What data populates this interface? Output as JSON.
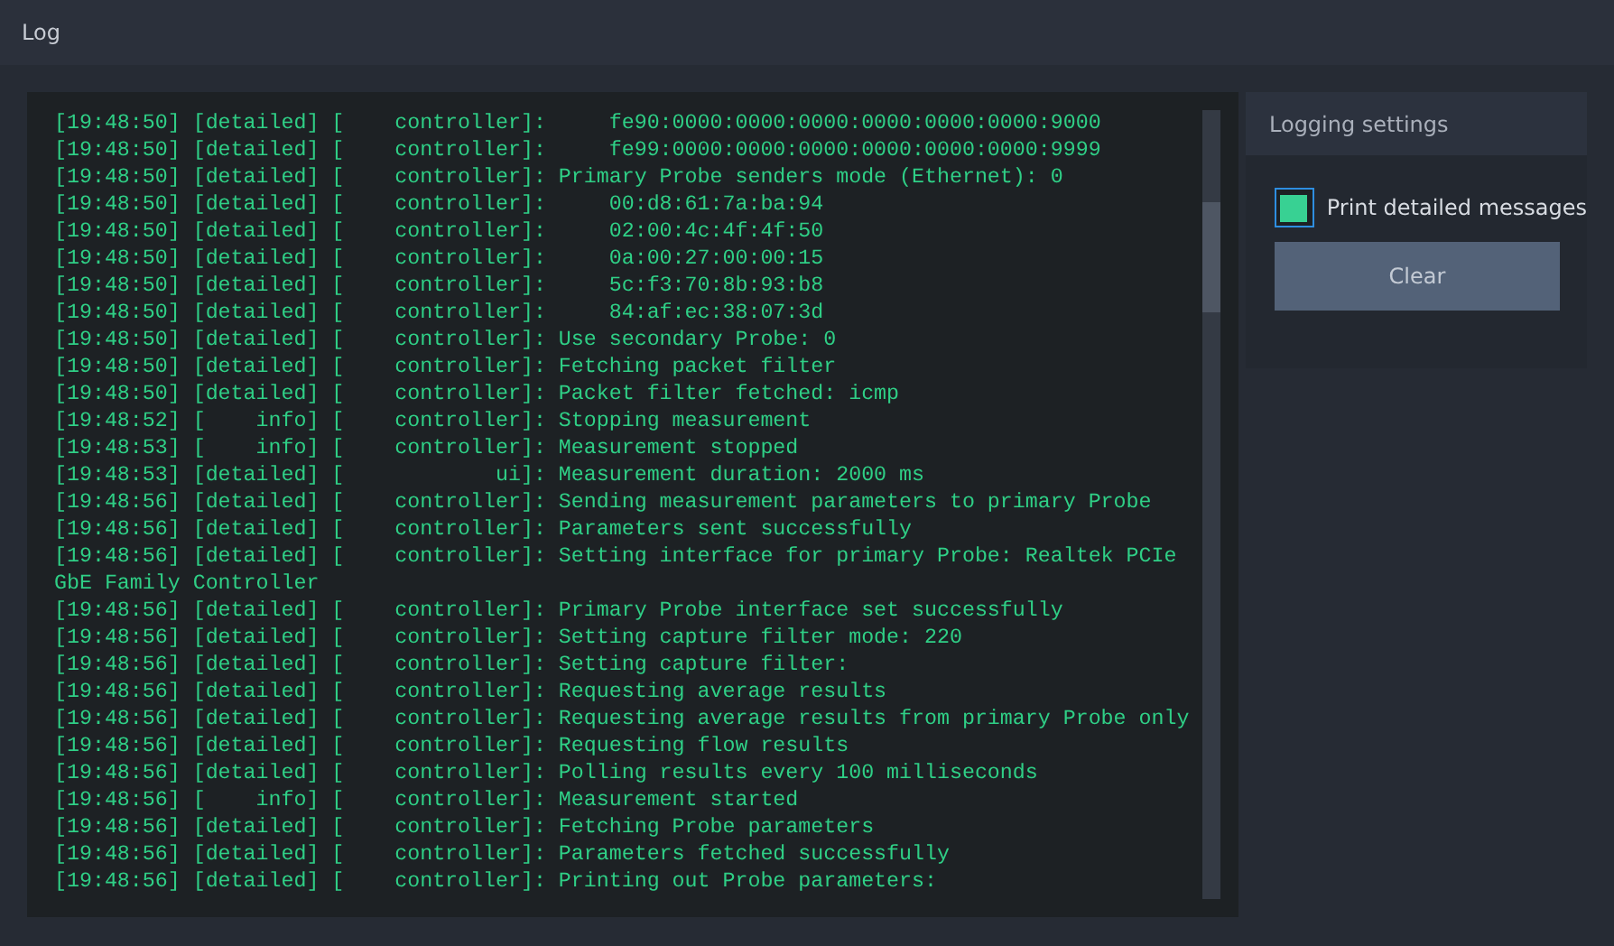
{
  "window": {
    "title": "Log"
  },
  "log": {
    "lines": [
      "[19:48:50] [detailed] [    controller]:     fe90:0000:0000:0000:0000:0000:0000:9000",
      "[19:48:50] [detailed] [    controller]:     fe99:0000:0000:0000:0000:0000:0000:9999",
      "[19:48:50] [detailed] [    controller]: Primary Probe senders mode (Ethernet): 0",
      "[19:48:50] [detailed] [    controller]:     00:d8:61:7a:ba:94",
      "[19:48:50] [detailed] [    controller]:     02:00:4c:4f:4f:50",
      "[19:48:50] [detailed] [    controller]:     0a:00:27:00:00:15",
      "[19:48:50] [detailed] [    controller]:     5c:f3:70:8b:93:b8",
      "[19:48:50] [detailed] [    controller]:     84:af:ec:38:07:3d",
      "[19:48:50] [detailed] [    controller]: Use secondary Probe: 0",
      "[19:48:50] [detailed] [    controller]: Fetching packet filter",
      "[19:48:50] [detailed] [    controller]: Packet filter fetched: icmp",
      "[19:48:52] [    info] [    controller]: Stopping measurement",
      "[19:48:53] [    info] [    controller]: Measurement stopped",
      "[19:48:53] [detailed] [            ui]: Measurement duration: 2000 ms",
      "[19:48:56] [detailed] [    controller]: Sending measurement parameters to primary Probe",
      "[19:48:56] [detailed] [    controller]: Parameters sent successfully",
      "[19:48:56] [detailed] [    controller]: Setting interface for primary Probe: Realtek PCIe GbE Family Controller",
      "[19:48:56] [detailed] [    controller]: Primary Probe interface set successfully",
      "[19:48:56] [detailed] [    controller]: Setting capture filter mode: 220",
      "[19:48:56] [detailed] [    controller]: Setting capture filter:",
      "[19:48:56] [detailed] [    controller]: Requesting average results",
      "[19:48:56] [detailed] [    controller]: Requesting average results from primary Probe only",
      "[19:48:56] [detailed] [    controller]: Requesting flow results",
      "[19:48:56] [detailed] [    controller]: Polling results every 100 milliseconds",
      "[19:48:56] [    info] [    controller]: Measurement started",
      "[19:48:56] [detailed] [    controller]: Fetching Probe parameters",
      "[19:48:56] [detailed] [    controller]: Parameters fetched successfully",
      "[19:48:56] [detailed] [    controller]: Printing out Probe parameters:"
    ]
  },
  "settings": {
    "title": "Logging settings",
    "print_detailed": {
      "label": "Print detailed messages",
      "checked": true
    },
    "clear_button": "Clear"
  }
}
